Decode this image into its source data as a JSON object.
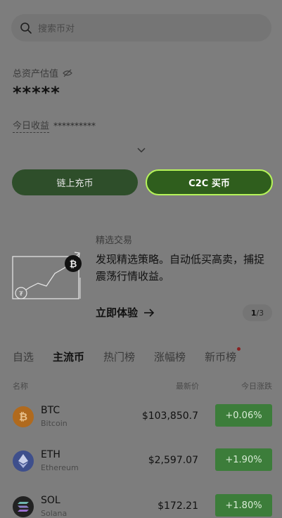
{
  "search": {
    "placeholder": "搜索币对"
  },
  "assets": {
    "label": "总资产估值",
    "value": "*****",
    "pnl_label": "今日收益",
    "pnl_value": "**********"
  },
  "buttons": {
    "onchain": "链上充币",
    "c2c": "C2C 买币"
  },
  "promo": {
    "title": "精选交易",
    "description": "发现精选策略。自动低买高卖，捕捉震荡行情收益。",
    "cta": "立即体验",
    "page_current": "1",
    "page_total": "/3"
  },
  "tabs": [
    "自选",
    "主流币",
    "热门榜",
    "涨幅榜",
    "新币榜"
  ],
  "table_header": {
    "name": "名称",
    "price": "最新价",
    "change": "今日涨跌"
  },
  "coins": [
    {
      "symbol": "BTC",
      "name": "Bitcoin",
      "price": "$103,850.7",
      "change": "+0.06%",
      "icon": "bitcoin-icon",
      "color": "#b06a1e"
    },
    {
      "symbol": "ETH",
      "name": "Ethereum",
      "price": "$2,597.07",
      "change": "+1.90%",
      "icon": "ethereum-icon",
      "color": "#3e4f8c"
    },
    {
      "symbol": "SOL",
      "name": "Solana",
      "price": "$172.21",
      "change": "+1.80%",
      "icon": "solana-icon",
      "color": "#222222"
    }
  ],
  "colors": {
    "accent": "#b7f55a",
    "up": "#3c7d3a"
  }
}
